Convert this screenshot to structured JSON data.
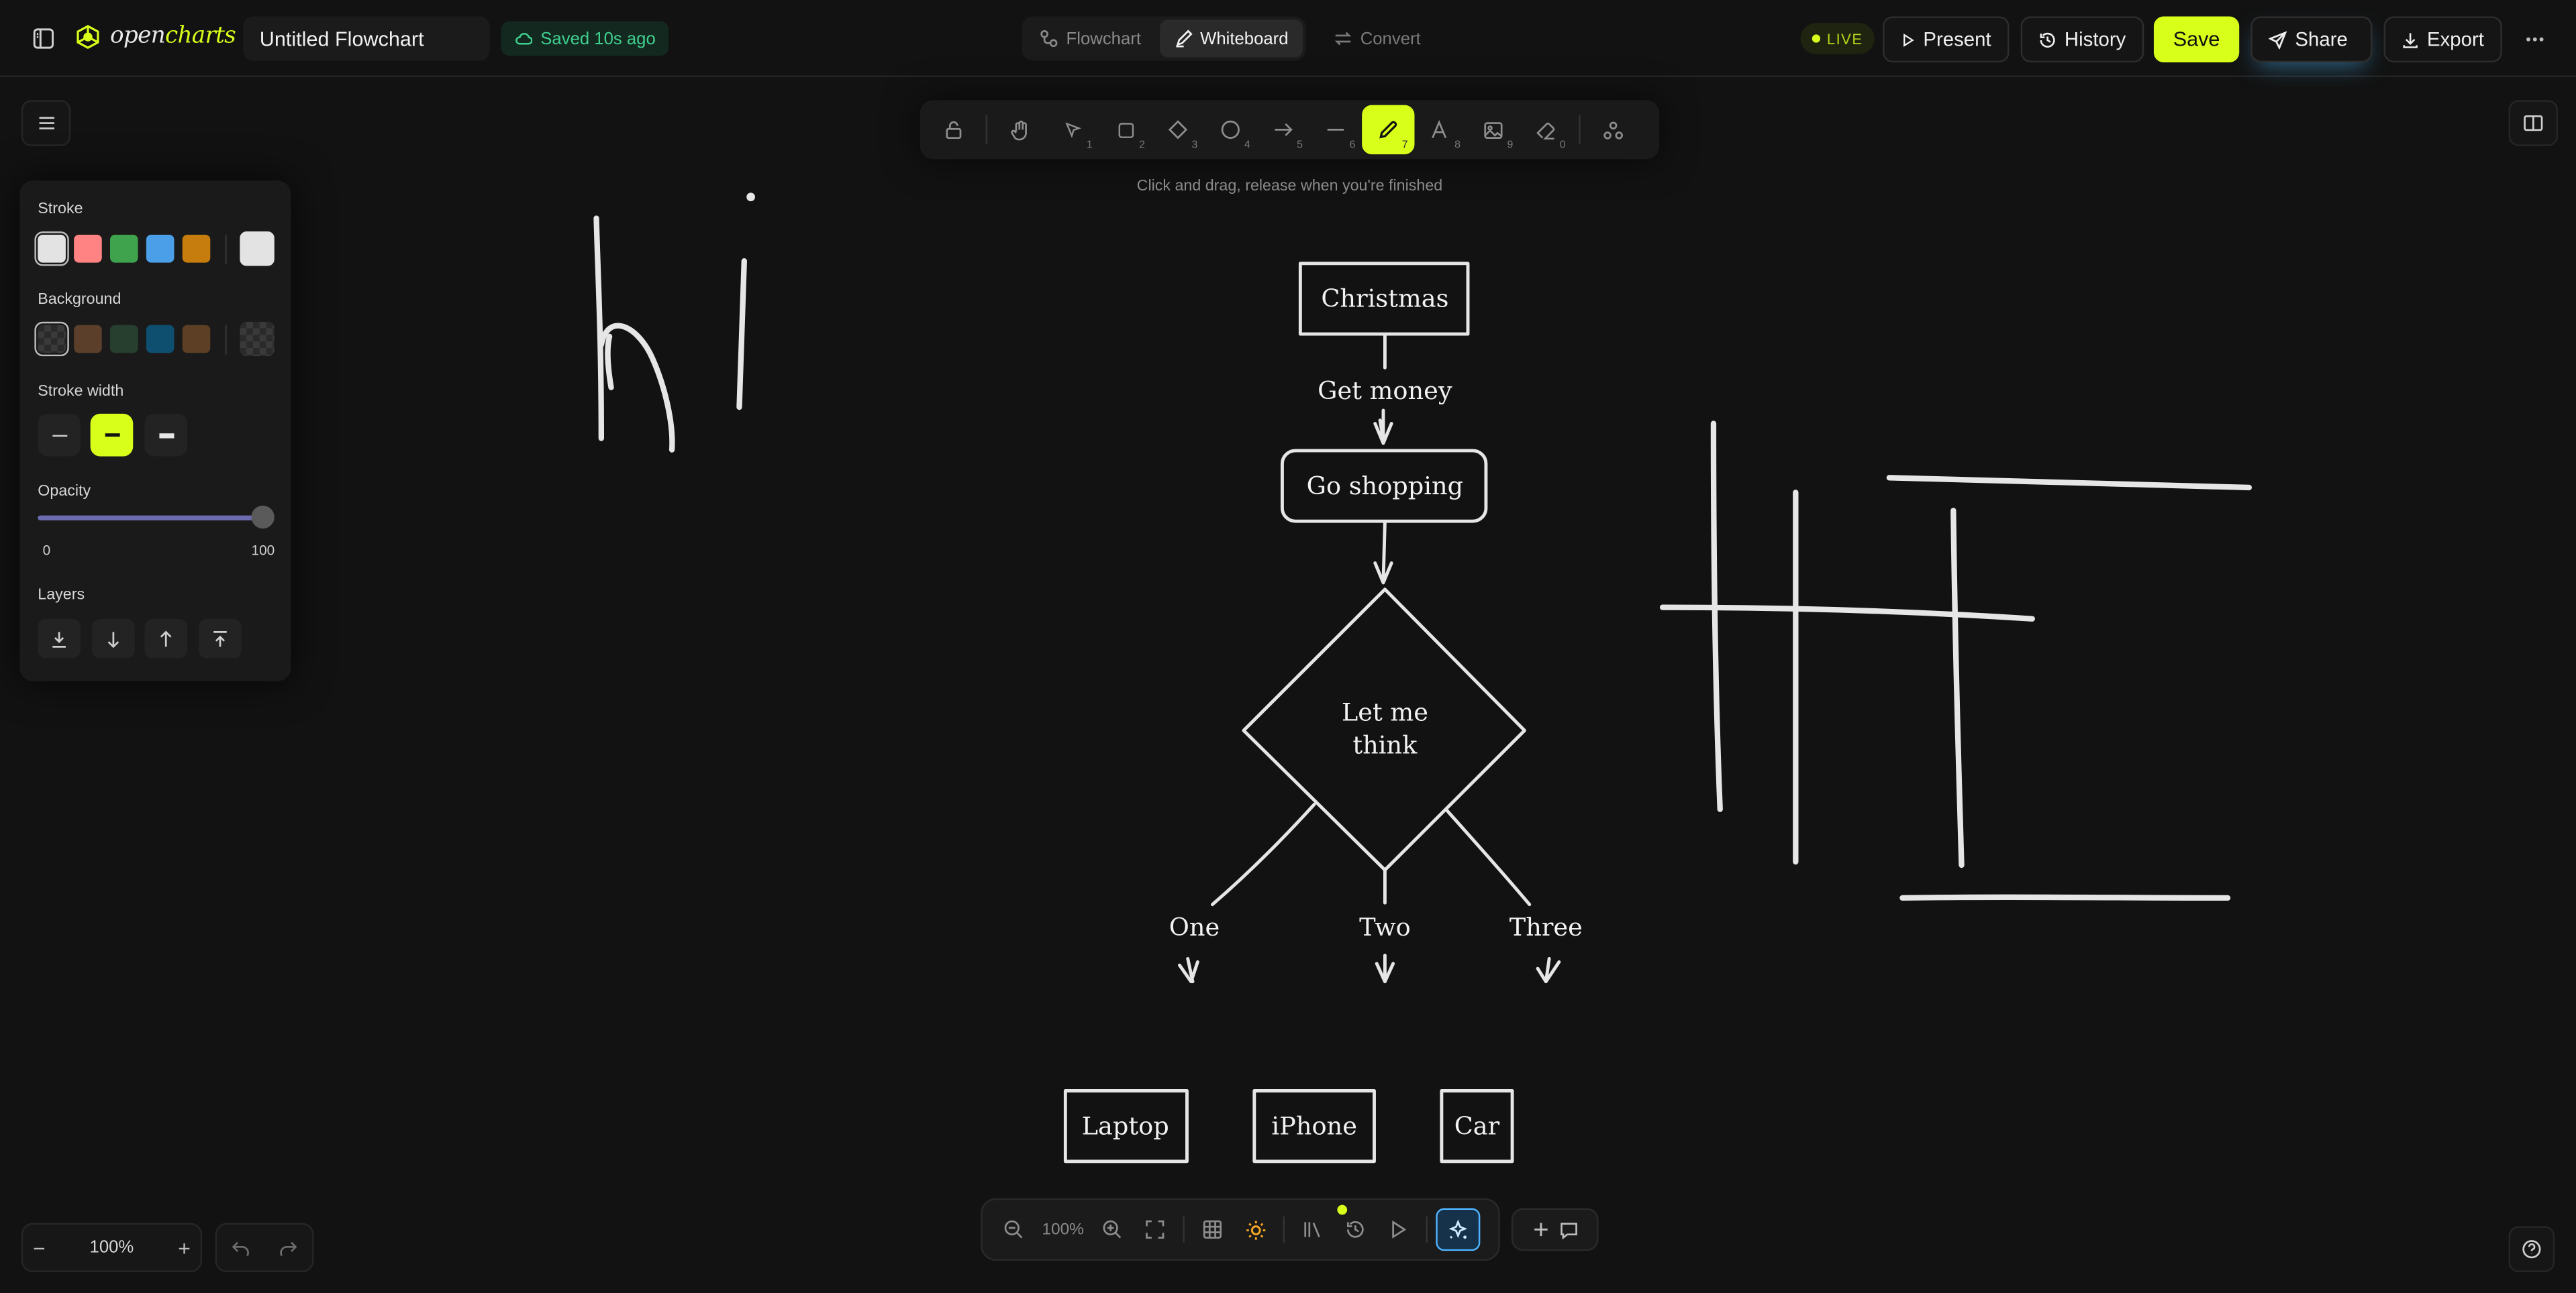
{
  "header": {
    "logo_prefix": "open",
    "logo_accent": "charts",
    "document_title": "Untitled Flowchart",
    "saved_status": "Saved 10s ago",
    "modes": [
      "Flowchart",
      "Whiteboard"
    ],
    "active_mode": "Whiteboard",
    "convert_label": "Convert",
    "live_label": "LIVE",
    "present_label": "Present",
    "history_label": "History",
    "save_label": "Save",
    "share_label": "Share",
    "export_label": "Export"
  },
  "toolbar": {
    "tools": [
      {
        "icon": "lock-icon",
        "key": ""
      },
      {
        "icon": "hand-icon",
        "key": ""
      },
      {
        "icon": "pointer-icon",
        "key": "1"
      },
      {
        "icon": "rectangle-icon",
        "key": "2"
      },
      {
        "icon": "diamond-icon",
        "key": "3"
      },
      {
        "icon": "ellipse-icon",
        "key": "4"
      },
      {
        "icon": "arrow-icon",
        "key": "5"
      },
      {
        "icon": "line-icon",
        "key": "6"
      },
      {
        "icon": "pencil-icon",
        "key": "7"
      },
      {
        "icon": "text-icon",
        "key": "8"
      },
      {
        "icon": "image-icon",
        "key": "9"
      },
      {
        "icon": "eraser-icon",
        "key": "0"
      },
      {
        "icon": "shapes-icon",
        "key": ""
      }
    ],
    "active_tool": "pencil",
    "hint": "Click and drag, release when you're finished"
  },
  "properties": {
    "stroke_label": "Stroke",
    "stroke_colors": [
      "#e3e3e3",
      "#ff8383",
      "#3fa34d",
      "#4a9fe8",
      "#c77c0e"
    ],
    "stroke_current": "#e3e3e3",
    "background_label": "Background",
    "background_colors": [
      "transparent",
      "#5b3f2a",
      "#263f2e",
      "#0e4f70",
      "#5c3f24"
    ],
    "stroke_width_label": "Stroke width",
    "opacity_label": "Opacity",
    "opacity_min": "0",
    "opacity_max": "100",
    "opacity_value": 100,
    "layers_label": "Layers"
  },
  "zoom": {
    "value": "100%"
  },
  "bottom_bar": {
    "zoom": "100%"
  },
  "flowchart": {
    "start": "Christmas",
    "edge1": "Get money",
    "step": "Go shopping",
    "decision_line1": "Let me",
    "decision_line2": "think",
    "branch1": "One",
    "branch2": "Two",
    "branch3": "Three",
    "out1": "Laptop",
    "out2": "iPhone",
    "out3": "Car"
  },
  "colors": {
    "accent": "#d8ff1a",
    "canvas": "#121212",
    "saved_green": "#3fcf8e"
  }
}
